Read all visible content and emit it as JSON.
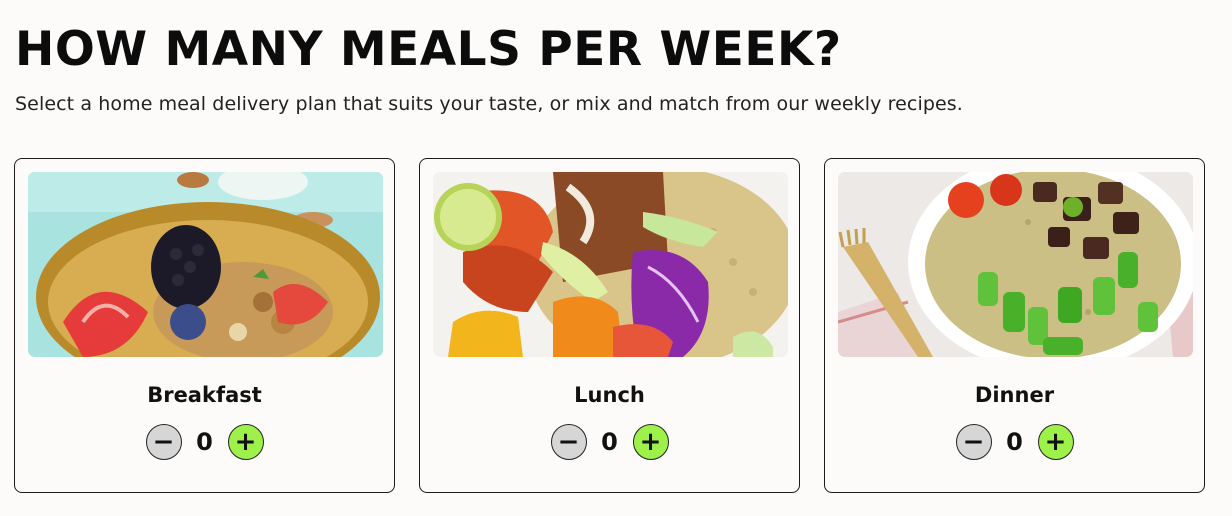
{
  "heading": "HOW MANY MEALS PER WEEK?",
  "subheading": "Select a home meal delivery plan that suits your taste, or mix and match from our weekly recipes.",
  "meals": [
    {
      "name": "Breakfast",
      "count": "0",
      "image": "breakfast-bowl-image",
      "minus_symbol": "−",
      "plus_symbol": "+"
    },
    {
      "name": "Lunch",
      "count": "0",
      "image": "lunch-bowl-image",
      "minus_symbol": "−",
      "plus_symbol": "+"
    },
    {
      "name": "Dinner",
      "count": "0",
      "image": "dinner-bowl-image",
      "minus_symbol": "−",
      "plus_symbol": "+"
    }
  ],
  "colors": {
    "accent_plus": "#9ef04a",
    "minus_bg": "#d6d6d6",
    "page_bg": "#fcfbf9",
    "border": "#1b1b1b"
  }
}
